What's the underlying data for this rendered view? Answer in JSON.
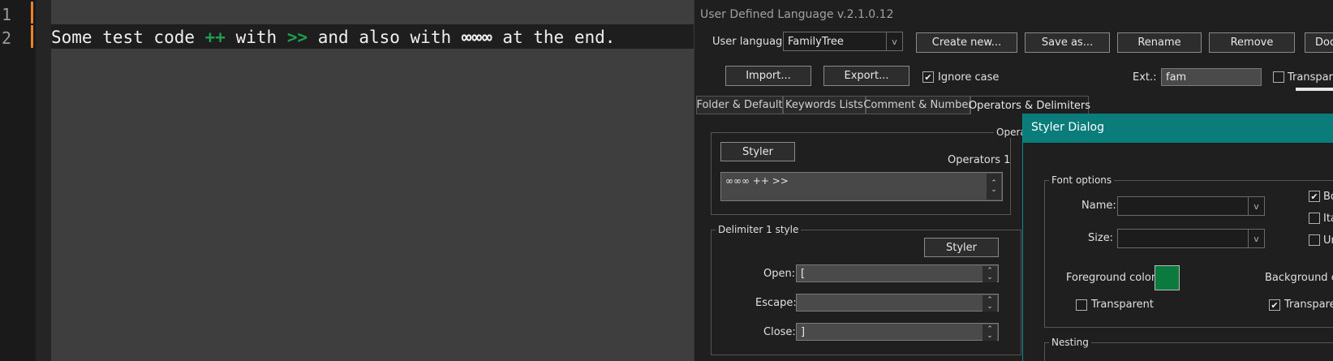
{
  "editor": {
    "line_numbers": [
      "1",
      "2"
    ],
    "code": {
      "t1": "Some test code ",
      "op1": "++",
      "t2": " with ",
      "op2": ">>",
      "t3": " and also with ",
      "op3": "∞∞∞",
      "t4": " at the end."
    }
  },
  "udl": {
    "title": "User Defined Language v.2.1.0.12",
    "user_language_label": "User language:",
    "user_language_value": "FamilyTree",
    "buttons": {
      "create_new": "Create new...",
      "save_as": "Save as...",
      "rename": "Rename",
      "remove": "Remove",
      "dock": "Doc",
      "import": "Import...",
      "export": "Export..."
    },
    "ignore_case_label": "Ignore case",
    "ignore_case_checked": true,
    "ext_label": "Ext.:",
    "ext_value": "fam",
    "transparency_label": "Transpare",
    "tabs": [
      "Folder & Default",
      "Keywords Lists",
      "Comment & Number",
      "Operators & Delimiters"
    ],
    "active_tab": 3,
    "operators_group_title": "Opera",
    "styler_label": "Styler",
    "operators1_label": "Operators 1",
    "operators1_value": "∞∞∞ ++ >>",
    "delimiter_group_title": "Delimiter 1 style",
    "delimiter_styler_label": "Styler",
    "open_label": "Open:",
    "open_value": "[",
    "escape_label": "Escape:",
    "escape_value": "",
    "close_label": "Close:",
    "close_value": "]"
  },
  "styler": {
    "title": "Styler Dialog",
    "font_options_title": "Font options",
    "name_label": "Name:",
    "name_value": "",
    "size_label": "Size:",
    "size_value": "",
    "bold_label": "Bo",
    "bold_checked": true,
    "italic_label": "Ita",
    "italic_checked": false,
    "underline_label": "Ur",
    "underline_checked": false,
    "foreground_label": "Foreground color:",
    "foreground_color": "#0c7a3e",
    "background_label": "Background col",
    "fg_transparent_label": "Transparent",
    "fg_transparent_checked": false,
    "bg_transparent_label": "Transparer",
    "bg_transparent_checked": true,
    "nesting_title": "Nesting"
  }
}
